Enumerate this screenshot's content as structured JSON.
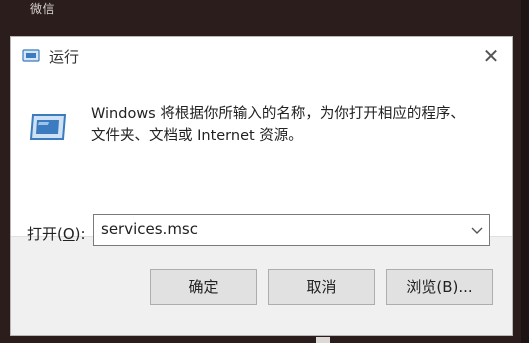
{
  "background": {
    "app_label": "微信"
  },
  "dialog": {
    "title": "运行",
    "close_label": "✕",
    "description": "Windows 将根据你所输入的名称，为你打开相应的程序、\n文件夹、文档或 Internet 资源。",
    "open_label_prefix": "打开(",
    "open_label_key": "O",
    "open_label_suffix": "):",
    "command_value": "services.msc",
    "buttons": {
      "ok": "确定",
      "cancel": "取消",
      "browse": "浏览(B)..."
    }
  },
  "colors": {
    "background": "#2a1d1b",
    "dialog_bg": "#f0f0f0",
    "button_bg": "#e1e1e1",
    "icon_blue": "#3b7bbf"
  },
  "icons": {
    "title": "run-icon",
    "body": "run-icon",
    "dropdown": "chevron-down-icon"
  }
}
